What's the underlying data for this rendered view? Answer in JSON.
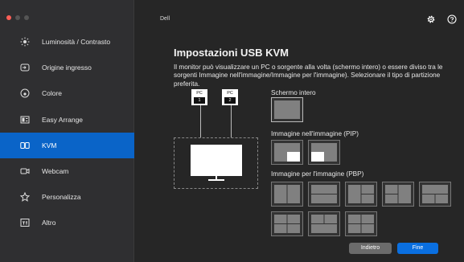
{
  "app": {
    "title": "Dell"
  },
  "sidebar": {
    "items": [
      {
        "label": "Luminosità / Contrasto",
        "icon": "brightness-icon"
      },
      {
        "label": "Origine ingresso",
        "icon": "input-source-icon"
      },
      {
        "label": "Colore",
        "icon": "color-icon"
      },
      {
        "label": "Easy Arrange",
        "icon": "easy-arrange-icon"
      },
      {
        "label": "KVM",
        "icon": "kvm-icon"
      },
      {
        "label": "Webcam",
        "icon": "webcam-icon"
      },
      {
        "label": "Personalizza",
        "icon": "star-icon"
      },
      {
        "label": "Altro",
        "icon": "other-icon"
      }
    ]
  },
  "main": {
    "title": "Impostazioni USB KVM",
    "description": "Il monitor può visualizzare un PC o sorgente alla volta (schermo intero) o essere diviso tra le sorgenti Immagine nell'immagine/Immagine per l'immagine). Selezionare il tipo di partizione preferita.",
    "pc1_label": "PC",
    "pc1_num": "1",
    "pc2_label": "PC",
    "pc2_num": "2",
    "full_label": "Schermo intero",
    "pip_label": "Immagine nell'immagine (PIP)",
    "pbp_label": "Immagine per l'immagine (PBP)"
  },
  "buttons": {
    "back": "Indietro",
    "done": "Fine"
  },
  "colors": {
    "accent": "#0a64c8",
    "primary_button": "#0a6fe0",
    "sidebar_bg": "#2f2f31"
  }
}
